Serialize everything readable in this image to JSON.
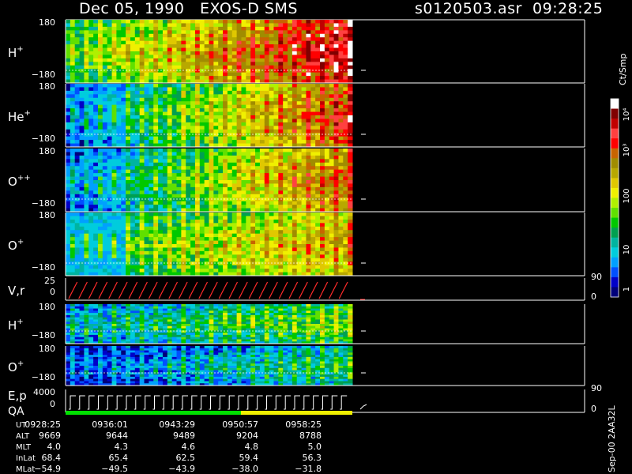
{
  "header": {
    "date": "Dec 05, 1990",
    "instrument": "EXOS-D SMS",
    "file": "s0120503.asr",
    "time": "09:28:25"
  },
  "footer_code": "Sep-00 2AA32L",
  "chart_data": {
    "type": "heatmap",
    "colorbar": {
      "label": "Ct/Smp",
      "scale": "log",
      "range": [
        1,
        10000
      ],
      "tick_labels": [
        "1",
        "10",
        "100",
        "10³",
        "10⁴"
      ],
      "colors": [
        "#00007a",
        "#0000c8",
        "#0050ff",
        "#00a0ff",
        "#00ccdd",
        "#00b4a0",
        "#00a050",
        "#00c800",
        "#60e000",
        "#b0f000",
        "#f0f000",
        "#e0c800",
        "#b8a800",
        "#a08c00",
        "#c86400",
        "#ff0000",
        "#ff4040",
        "#c00000",
        "#800000",
        "#ffffff"
      ]
    },
    "panels": [
      {
        "label": "H",
        "sup": "+",
        "ymax": "180",
        "ymin": "−180",
        "kind": "spectrogram",
        "profile": "h1"
      },
      {
        "label": "He",
        "sup": "+",
        "ymax": "180",
        "ymin": "−180",
        "kind": "spectrogram",
        "profile": "he"
      },
      {
        "label": "O",
        "sup": "++",
        "ymax": "180",
        "ymin": "−180",
        "kind": "spectrogram",
        "profile": "o2"
      },
      {
        "label": "O",
        "sup": "+",
        "ymax": "180",
        "ymin": "−180",
        "kind": "spectrogram",
        "profile": "o1"
      },
      {
        "label": "V,r",
        "sup": "",
        "ymax": "25",
        "ymin": "0",
        "kind": "line",
        "right_top": "90",
        "right_bottom": "0"
      },
      {
        "label": "H",
        "sup": "+",
        "ymax": "180",
        "ymin": "−180",
        "kind": "spectrogram",
        "profile": "h2"
      },
      {
        "label": "O",
        "sup": "+",
        "ymax": "180",
        "ymin": "−180",
        "kind": "spectrogram",
        "profile": "o3"
      },
      {
        "label": "E,p",
        "sup": "",
        "label2": "QA",
        "ymax": "4000",
        "ymin": "0",
        "kind": "steps",
        "right_top": "90",
        "right_bottom": "0"
      }
    ],
    "qa_bar": [
      {
        "from": "0928:25",
        "to": "0950:57",
        "color": "#00e000"
      },
      {
        "from": "0950:57",
        "to": "0958:25",
        "color": "#f0f000"
      }
    ],
    "ephemeris": {
      "rows": [
        {
          "name": "UT",
          "values": [
            "0928:25",
            "0936:01",
            "0943:29",
            "0950:57",
            "0958:25"
          ]
        },
        {
          "name": "ALT",
          "values": [
            "9669",
            "9644",
            "9489",
            "9204",
            "8788"
          ]
        },
        {
          "name": "MLT",
          "values": [
            "4.0",
            "4.3",
            "4.6",
            "4.8",
            "5.0"
          ]
        },
        {
          "name": "InLat",
          "values": [
            "68.4",
            "65.4",
            "62.5",
            "59.4",
            "56.3"
          ]
        },
        {
          "name": "MLat",
          "values": [
            "−54.9",
            "−49.5",
            "−43.9",
            "−38.0",
            "−31.8"
          ]
        }
      ]
    }
  }
}
